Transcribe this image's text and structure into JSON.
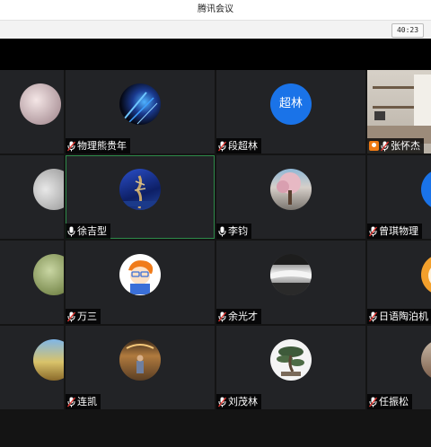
{
  "window": {
    "title": "腾讯会议"
  },
  "toolbar": {
    "timer": "40:23"
  },
  "participants": {
    "p1": {
      "name": "",
      "avatar": "stage-lights-photo",
      "muted": true
    },
    "p2": {
      "name": "物理熊贵年",
      "avatar": "stage-lights-photo",
      "muted": true
    },
    "p3": {
      "name": "段超林",
      "avatar_text": "超林",
      "muted": true
    },
    "p4": {
      "name": "张怀杰",
      "avatar": "room-camera-video",
      "muted": true,
      "sharing_icon": "user-icon"
    },
    "p5": {
      "name": "徐吉型",
      "avatar": "blue-sculpture-photo",
      "muted": false,
      "active": true
    },
    "p6": {
      "name": "李钧",
      "avatar": "blossom-tree-photo",
      "muted": false
    },
    "p7": {
      "name": "曾琪物理",
      "avatar": "blue-circle",
      "muted": true
    },
    "p8": {
      "name": "万三",
      "avatar": "cartoon-boy",
      "muted": true
    },
    "p9": {
      "name": "余光才",
      "avatar": "waterfall-photo",
      "muted": true
    },
    "p10": {
      "name": "日语陶泊机",
      "avatar": "cartoon-orange",
      "muted": true
    },
    "p11": {
      "name": "连凯",
      "avatar": "hall-photo",
      "muted": true
    },
    "p12": {
      "name": "刘茂林",
      "avatar": "bonsai-tree-photo",
      "muted": true
    },
    "p13": {
      "name": "任振松",
      "avatar": "person-photo",
      "muted": true
    }
  },
  "colors": {
    "tile_bg": "#222326",
    "avatar_blue": "#1a73e8",
    "active_border": "#2e8b4a",
    "mute_red": "#e0342f"
  }
}
